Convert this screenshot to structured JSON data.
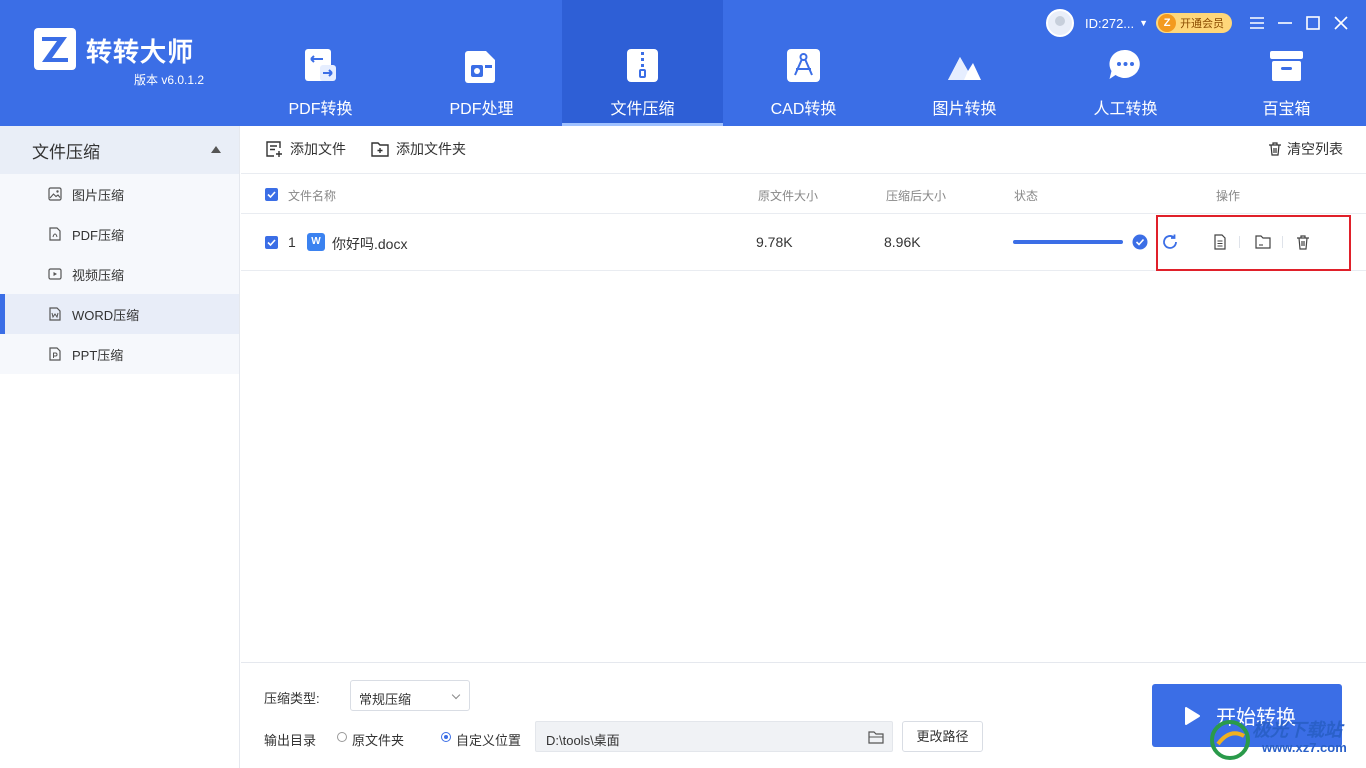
{
  "app": {
    "brand": "转转大师",
    "version": "版本 v6.0.1.2",
    "user_id": "ID:272...",
    "vip_badge": "Z",
    "vip_label": "开通会员"
  },
  "nav": {
    "tabs": [
      {
        "label": "PDF转换",
        "icon": "pdf-convert-icon"
      },
      {
        "label": "PDF处理",
        "icon": "pdf-process-icon"
      },
      {
        "label": "文件压缩",
        "icon": "file-compress-icon",
        "active": true
      },
      {
        "label": "CAD转换",
        "icon": "cad-convert-icon"
      },
      {
        "label": "图片转换",
        "icon": "image-convert-icon"
      },
      {
        "label": "人工转换",
        "icon": "manual-convert-icon"
      },
      {
        "label": "百宝箱",
        "icon": "toolbox-icon"
      }
    ]
  },
  "sidebar": {
    "header": "文件压缩",
    "items": [
      {
        "label": "图片压缩",
        "icon": "image-icon"
      },
      {
        "label": "PDF压缩",
        "icon": "pdf-icon"
      },
      {
        "label": "视频压缩",
        "icon": "video-icon"
      },
      {
        "label": "WORD压缩",
        "icon": "word-icon",
        "active": true
      },
      {
        "label": "PPT压缩",
        "icon": "ppt-icon"
      }
    ]
  },
  "toolbar": {
    "add_file": "添加文件",
    "add_folder": "添加文件夹",
    "clear_list": "清空列表"
  },
  "table": {
    "headers": {
      "name": "文件名称",
      "original_size": "原文件大小",
      "compressed_size": "压缩后大小",
      "status": "状态",
      "actions": "操作"
    },
    "rows": [
      {
        "index": "1",
        "file_icon": "W",
        "name": "你好吗.docx",
        "original_size": "9.78K",
        "compressed_size": "8.96K",
        "progress": 1.0
      }
    ]
  },
  "bottom": {
    "compress_type_label": "压缩类型:",
    "compress_type_value": "常规压缩",
    "output_label": "输出目录",
    "option_original": "原文件夹",
    "option_custom": "自定义位置",
    "output_path": "D:\\tools\\桌面",
    "change_path": "更改路径",
    "start": "开始转换"
  },
  "watermark": {
    "text": "极光下载站",
    "url": "www.xz7.com"
  },
  "colors": {
    "primary": "#3b6ee6",
    "highlight": "#e0202a"
  }
}
